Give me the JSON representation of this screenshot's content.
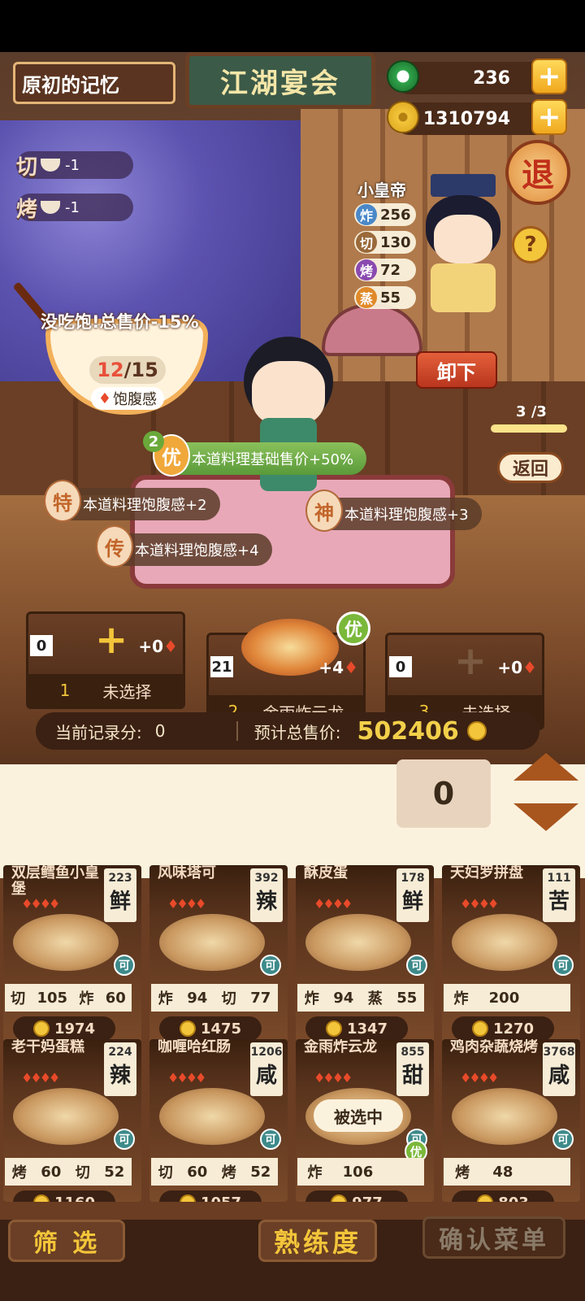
{
  "header": {
    "save_name": "原初的记忆",
    "banner_title": "江湖宴会",
    "jade_count": "236",
    "coin_count": "1310794",
    "exit_label": "退",
    "help_label": "?"
  },
  "skills": [
    {
      "char": "切",
      "value": "-1",
      "icon": "bowl-icon"
    },
    {
      "char": "烤",
      "value": "-1",
      "icon": "bowl-icon"
    }
  ],
  "customer": {
    "name": "小皇帝",
    "stats": [
      {
        "char": "炸",
        "value": "256",
        "color": "#4a88c8"
      },
      {
        "char": "切",
        "value": "130",
        "color": "#9a6a3a"
      },
      {
        "char": "烤",
        "value": "72",
        "color": "#8a4ab0"
      },
      {
        "char": "蒸",
        "value": "55",
        "color": "#e08a2a"
      }
    ]
  },
  "satiety": {
    "warning": "没吃饱!总售价-15%",
    "current": "12",
    "max": "/15",
    "label": "饱腹感"
  },
  "actions": {
    "unload": "卸下",
    "page": "3 /3",
    "back": "返回"
  },
  "buffs": [
    {
      "badge": "优",
      "count": "2",
      "text": "本道料理基础售价+50%"
    },
    {
      "badge": "特",
      "text": "本道料理饱腹感+2"
    },
    {
      "badge": "神",
      "text": "本道料理饱腹感+3"
    },
    {
      "badge": "传",
      "text": "本道料理饱腹感+4"
    }
  ],
  "slots": [
    {
      "num": "0",
      "index": "1",
      "label": "未选择",
      "heat": "+0"
    },
    {
      "num": "21",
      "index": "2",
      "label": "金雨炸云龙",
      "heat": "+4",
      "badge": "优"
    },
    {
      "num": "0",
      "index": "3",
      "label": "未选择",
      "heat": "+0"
    }
  ],
  "score": {
    "record_label": "当前记录分:",
    "record_value": "0",
    "total_label": "预计总售价:",
    "total_value": "502406"
  },
  "quantity": {
    "value": "0"
  },
  "dishes": [
    {
      "name": "双层鳕鱼小皇堡",
      "count": "223",
      "flavor": "鲜",
      "stats": [
        "切",
        "105",
        "炸",
        "60"
      ],
      "price": "1974"
    },
    {
      "name": "风味塔可",
      "count": "392",
      "flavor": "辣",
      "stats": [
        "炸",
        "94",
        "切",
        "77"
      ],
      "price": "1475"
    },
    {
      "name": "酥皮蛋",
      "count": "178",
      "flavor": "鲜",
      "stats": [
        "炸",
        "94",
        "蒸",
        "55"
      ],
      "price": "1347"
    },
    {
      "name": "天妇罗拼盘",
      "count": "111",
      "flavor": "苦",
      "stats": [
        "炸",
        "200",
        "",
        ""
      ],
      "price": "1270"
    },
    {
      "name": "老干妈蛋糕",
      "count": "224",
      "flavor": "辣",
      "stats": [
        "烤",
        "60",
        "切",
        "52"
      ],
      "price": "1160"
    },
    {
      "name": "咖喱哈红肠",
      "count": "1206",
      "flavor": "咸",
      "stats": [
        "切",
        "60",
        "烤",
        "52"
      ],
      "price": "1057"
    },
    {
      "name": "金雨炸云龙",
      "count": "855",
      "flavor": "甜",
      "stats": [
        "炸",
        "106",
        "",
        ""
      ],
      "price": "977",
      "selected": "被选中",
      "badge": "优"
    },
    {
      "name": "鸡肉杂蔬烧烤",
      "count": "3768",
      "flavor": "咸",
      "stats": [
        "烤",
        "48",
        "",
        ""
      ],
      "price": "803"
    }
  ],
  "badges": {
    "ke": "可"
  },
  "bottom": {
    "filter": "筛 选",
    "proficiency": "熟练度",
    "confirm": "确认菜单"
  }
}
